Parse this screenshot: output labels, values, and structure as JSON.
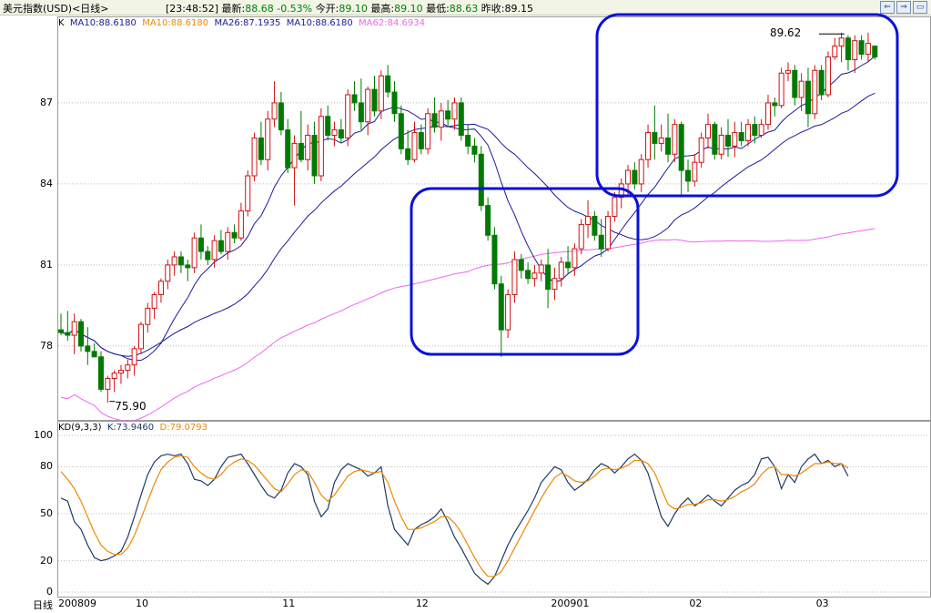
{
  "header": {
    "name": "美元指数(USD)<日线>",
    "time": "[23:48:52]",
    "latest_label": "最新:",
    "latest_value": "88.68",
    "change": "-0.53%",
    "open_label": "今开:",
    "open_value": "89.10",
    "high_label": "最高:",
    "high_value": "89.10",
    "low_label": "最低:",
    "low_value": "88.63",
    "prev_label": "昨收:",
    "prev_value": "89.15"
  },
  "window_buttons": [
    {
      "name": "back-icon",
      "glyph": "⇐"
    },
    {
      "name": "forward-icon",
      "glyph": "⇒"
    },
    {
      "name": "close-icon",
      "glyph": "▭"
    }
  ],
  "ma_legend": {
    "k": "K",
    "ma10a": "MA10:88.6180",
    "ma10b": "MA10:88.6180",
    "ma26": "MA26:87.1935",
    "ma10c": "MA10:88.6180",
    "ma62": "MA62:84.6934"
  },
  "kd_legend": {
    "name": "KD(9,3,3)",
    "k": "K:73.9460",
    "d": "D:79.0793"
  },
  "annotations": {
    "high_mark": "89.62",
    "low_mark": "75.90"
  },
  "footer": {
    "period_label": "日线"
  },
  "colors": {
    "up": "#d01010",
    "down": "#007a00",
    "ma10": "#1a1a9a",
    "ma26": "#1a1a9a",
    "ma62": "#ee66ee",
    "kd_k": "#1f3a66",
    "kd_d": "#ee8800",
    "highlight": "#0a10d8"
  },
  "chart_data": [
    {
      "type": "candlestick",
      "y_ticks": [
        "87",
        "84",
        "81",
        "78"
      ],
      "ylim": [
        75.3,
        90.2
      ],
      "x_ticks": [
        "200809",
        "10",
        "11",
        "12",
        "200901",
        "02",
        "03"
      ],
      "candles": [
        [
          78.6,
          79.2,
          78.4,
          78.5
        ],
        [
          78.5,
          79.3,
          78.2,
          78.4
        ],
        [
          78.4,
          79.2,
          77.7,
          78.9
        ],
        [
          78.9,
          79.0,
          77.8,
          78.0
        ],
        [
          78.0,
          78.7,
          77.3,
          77.8
        ],
        [
          77.8,
          78.1,
          77.6,
          77.6
        ],
        [
          77.6,
          77.8,
          76.3,
          76.4
        ],
        [
          76.4,
          76.9,
          75.9,
          76.8
        ],
        [
          76.8,
          77.1,
          76.3,
          77.0
        ],
        [
          77.0,
          77.3,
          76.6,
          77.1
        ],
        [
          77.1,
          77.5,
          76.8,
          77.3
        ],
        [
          77.3,
          78.0,
          76.9,
          77.9
        ],
        [
          77.9,
          78.9,
          77.7,
          78.8
        ],
        [
          78.8,
          79.6,
          78.5,
          79.4
        ],
        [
          79.4,
          80.0,
          79.0,
          79.9
        ],
        [
          79.9,
          80.5,
          79.6,
          80.4
        ],
        [
          80.4,
          81.2,
          80.1,
          81.0
        ],
        [
          81.0,
          81.5,
          80.6,
          81.3
        ],
        [
          81.3,
          81.5,
          80.7,
          81.0
        ],
        [
          81.0,
          81.2,
          80.4,
          80.9
        ],
        [
          80.9,
          82.2,
          80.7,
          82.0
        ],
        [
          82.0,
          82.5,
          81.2,
          81.5
        ],
        [
          81.5,
          81.7,
          81.0,
          81.2
        ],
        [
          81.2,
          82.1,
          80.9,
          81.9
        ],
        [
          81.9,
          82.3,
          81.4,
          81.5
        ],
        [
          81.5,
          82.4,
          81.2,
          82.2
        ],
        [
          82.2,
          82.5,
          81.8,
          82.0
        ],
        [
          82.0,
          83.3,
          81.9,
          83.0
        ],
        [
          83.0,
          84.5,
          82.8,
          84.3
        ],
        [
          84.3,
          85.9,
          84.1,
          85.7
        ],
        [
          85.7,
          86.3,
          84.7,
          84.9
        ],
        [
          84.9,
          86.7,
          84.5,
          86.4
        ],
        [
          86.4,
          87.8,
          86.1,
          87.0
        ],
        [
          87.0,
          87.4,
          85.8,
          86.0
        ],
        [
          86.0,
          86.4,
          84.4,
          84.6
        ],
        [
          84.6,
          85.8,
          83.2,
          85.5
        ],
        [
          85.5,
          86.7,
          84.8,
          84.9
        ],
        [
          84.9,
          86.2,
          84.5,
          85.8
        ],
        [
          85.8,
          86.3,
          84.0,
          84.3
        ],
        [
          84.3,
          86.8,
          84.1,
          86.5
        ],
        [
          86.5,
          86.9,
          85.6,
          85.8
        ],
        [
          85.8,
          86.3,
          85.4,
          86.0
        ],
        [
          86.0,
          86.4,
          85.5,
          85.7
        ],
        [
          85.7,
          87.5,
          85.4,
          87.3
        ],
        [
          87.3,
          87.8,
          86.7,
          87.0
        ],
        [
          87.0,
          87.9,
          86.0,
          86.3
        ],
        [
          86.3,
          87.6,
          85.8,
          87.5
        ],
        [
          87.5,
          88.0,
          86.5,
          86.7
        ],
        [
          86.7,
          88.2,
          86.4,
          88.0
        ],
        [
          88.0,
          88.4,
          87.2,
          87.4
        ],
        [
          87.4,
          87.8,
          86.3,
          86.6
        ],
        [
          86.6,
          86.9,
          85.1,
          85.3
        ],
        [
          85.3,
          86.0,
          84.7,
          84.9
        ],
        [
          84.9,
          86.3,
          84.8,
          85.9
        ],
        [
          85.9,
          86.2,
          85.1,
          85.3
        ],
        [
          85.3,
          86.8,
          85.1,
          86.6
        ],
        [
          86.6,
          87.2,
          85.9,
          86.1
        ],
        [
          86.1,
          87.0,
          85.6,
          86.7
        ],
        [
          86.7,
          87.1,
          86.1,
          86.4
        ],
        [
          86.4,
          87.2,
          86.0,
          87.0
        ],
        [
          87.0,
          87.2,
          85.6,
          85.8
        ],
        [
          85.8,
          86.2,
          85.1,
          85.4
        ],
        [
          85.4,
          85.7,
          84.8,
          85.1
        ],
        [
          85.1,
          85.4,
          83.0,
          83.2
        ],
        [
          83.2,
          83.5,
          81.9,
          82.1
        ],
        [
          82.1,
          82.4,
          80.1,
          80.3
        ],
        [
          80.3,
          80.6,
          77.6,
          78.6
        ],
        [
          78.6,
          80.1,
          78.3,
          79.9
        ],
        [
          79.9,
          81.5,
          79.6,
          81.2
        ],
        [
          81.2,
          81.4,
          80.5,
          80.8
        ],
        [
          80.8,
          81.1,
          80.3,
          80.5
        ],
        [
          80.5,
          81.0,
          80.2,
          80.7
        ],
        [
          80.7,
          81.2,
          80.4,
          81.0
        ],
        [
          81.0,
          81.6,
          79.4,
          80.1
        ],
        [
          80.1,
          80.9,
          79.7,
          80.5
        ],
        [
          80.5,
          81.3,
          80.2,
          81.1
        ],
        [
          81.1,
          81.7,
          80.7,
          80.9
        ],
        [
          80.9,
          81.8,
          80.6,
          81.6
        ],
        [
          81.6,
          82.7,
          81.4,
          82.5
        ],
        [
          82.5,
          83.4,
          82.0,
          82.8
        ],
        [
          82.8,
          83.0,
          81.9,
          82.1
        ],
        [
          82.1,
          82.7,
          81.3,
          81.6
        ],
        [
          81.6,
          83.0,
          81.5,
          82.8
        ],
        [
          82.8,
          83.7,
          82.6,
          83.5
        ],
        [
          83.5,
          84.2,
          83.1,
          84.0
        ],
        [
          84.0,
          84.7,
          83.6,
          84.5
        ],
        [
          84.5,
          84.8,
          83.8,
          84.0
        ],
        [
          84.0,
          85.1,
          83.7,
          84.9
        ],
        [
          84.9,
          86.2,
          84.6,
          85.9
        ],
        [
          85.9,
          86.9,
          84.9,
          85.5
        ],
        [
          85.5,
          86.2,
          85.2,
          85.7
        ],
        [
          85.7,
          86.6,
          84.8,
          85.1
        ],
        [
          85.1,
          86.4,
          84.8,
          86.2
        ],
        [
          86.2,
          86.3,
          83.5,
          84.5
        ],
        [
          84.5,
          84.9,
          83.7,
          84.1
        ],
        [
          84.1,
          85.1,
          83.9,
          84.8
        ],
        [
          84.8,
          85.9,
          84.6,
          85.7
        ],
        [
          85.7,
          86.6,
          85.3,
          86.2
        ],
        [
          86.2,
          86.3,
          84.9,
          85.1
        ],
        [
          85.1,
          86.1,
          84.9,
          85.8
        ],
        [
          85.8,
          86.4,
          85.0,
          85.4
        ],
        [
          85.4,
          86.3,
          85.0,
          85.9
        ],
        [
          85.9,
          86.3,
          85.4,
          85.6
        ],
        [
          85.6,
          86.4,
          85.4,
          86.2
        ],
        [
          86.2,
          86.5,
          85.5,
          85.8
        ],
        [
          85.8,
          86.4,
          85.7,
          86.2
        ],
        [
          86.2,
          87.3,
          86.0,
          87.0
        ],
        [
          87.0,
          87.2,
          86.5,
          86.9
        ],
        [
          86.9,
          88.3,
          86.8,
          88.1
        ],
        [
          88.1,
          88.5,
          87.8,
          88.2
        ],
        [
          88.2,
          88.4,
          86.9,
          87.2
        ],
        [
          87.2,
          88.1,
          86.7,
          87.8
        ],
        [
          87.8,
          88.3,
          86.1,
          86.6
        ],
        [
          86.6,
          88.4,
          86.4,
          88.2
        ],
        [
          88.2,
          88.4,
          87.1,
          87.3
        ],
        [
          87.3,
          88.9,
          87.2,
          88.7
        ],
        [
          88.7,
          89.4,
          88.6,
          89.1
        ],
        [
          89.1,
          89.6,
          88.5,
          89.4
        ],
        [
          89.4,
          89.5,
          88.2,
          88.6
        ],
        [
          88.6,
          89.5,
          88.1,
          89.3
        ],
        [
          89.3,
          89.5,
          88.6,
          88.8
        ],
        [
          88.8,
          89.6,
          88.5,
          89.2
        ],
        [
          89.1,
          89.1,
          88.6,
          88.7
        ]
      ]
    },
    {
      "type": "line",
      "name": "KD(9,3,3)",
      "y_ticks": [
        "100",
        "80",
        "50",
        "20",
        "0"
      ],
      "ylim": [
        0,
        100
      ],
      "series": [
        {
          "name": "K",
          "values": [
            60,
            58,
            45,
            40,
            30,
            22,
            20,
            21,
            23,
            26,
            35,
            48,
            62,
            75,
            83,
            87,
            88,
            87,
            88,
            82,
            72,
            71,
            68,
            72,
            80,
            86,
            87,
            88,
            82,
            75,
            68,
            62,
            60,
            65,
            76,
            82,
            80,
            75,
            58,
            48,
            53,
            70,
            78,
            82,
            80,
            78,
            74,
            76,
            80,
            55,
            40,
            35,
            30,
            40,
            43,
            45,
            48,
            53,
            45,
            35,
            28,
            20,
            12,
            8,
            5,
            10,
            20,
            30,
            38,
            45,
            52,
            60,
            70,
            75,
            80,
            78,
            70,
            65,
            68,
            72,
            78,
            82,
            80,
            76,
            80,
            85,
            88,
            84,
            76,
            62,
            48,
            42,
            50,
            56,
            60,
            55,
            58,
            62,
            58,
            55,
            60,
            65,
            68,
            70,
            75,
            85,
            86,
            80,
            66,
            75,
            70,
            80,
            85,
            88,
            82,
            84,
            80,
            82,
            74
          ]
        },
        {
          "name": "D",
          "values": [
            77,
            72,
            66,
            58,
            48,
            38,
            30,
            26,
            24,
            24,
            28,
            36,
            47,
            58,
            69,
            78,
            83,
            86,
            87,
            86,
            80,
            76,
            73,
            72,
            75,
            80,
            83,
            85,
            84,
            81,
            76,
            71,
            66,
            64,
            69,
            75,
            78,
            77,
            70,
            62,
            58,
            62,
            68,
            74,
            77,
            78,
            77,
            76,
            77,
            70,
            58,
            48,
            40,
            40,
            41,
            43,
            45,
            48,
            48,
            44,
            38,
            30,
            22,
            15,
            10,
            10,
            13,
            20,
            28,
            36,
            44,
            52,
            60,
            67,
            73,
            76,
            74,
            71,
            70,
            71,
            74,
            78,
            79,
            78,
            79,
            81,
            84,
            84,
            82,
            76,
            66,
            56,
            53,
            54,
            56,
            56,
            57,
            59,
            59,
            58,
            59,
            61,
            64,
            66,
            69,
            75,
            79,
            80,
            75,
            75,
            74,
            76,
            79,
            82,
            82,
            83,
            82,
            82,
            79
          ]
        }
      ]
    }
  ]
}
